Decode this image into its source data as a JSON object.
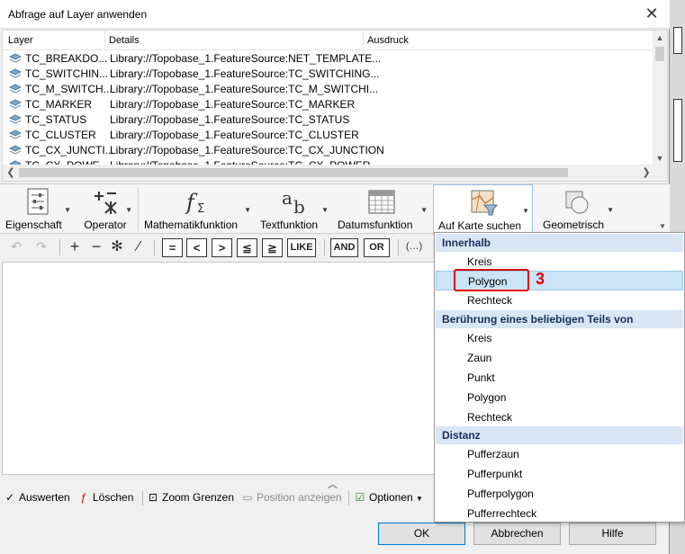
{
  "dialog": {
    "title": "Abfrage auf Layer anwenden",
    "close_glyph": "✕"
  },
  "layer_list": {
    "columns": [
      "Layer",
      "Details",
      "Ausdruck"
    ],
    "rows": [
      {
        "layer": "TC_BREAKDO...",
        "details": "Library://Topobase_1.FeatureSource:NET_TEMPLATE..."
      },
      {
        "layer": "TC_SWITCHIN...",
        "details": "Library://Topobase_1.FeatureSource:TC_SWITCHING..."
      },
      {
        "layer": "TC_M_SWITCH...",
        "details": "Library://Topobase_1.FeatureSource:TC_M_SWITCHI..."
      },
      {
        "layer": "TC_MARKER",
        "details": "Library://Topobase_1.FeatureSource:TC_MARKER"
      },
      {
        "layer": "TC_STATUS",
        "details": "Library://Topobase_1.FeatureSource:TC_STATUS"
      },
      {
        "layer": "TC_CLUSTER",
        "details": "Library://Topobase_1.FeatureSource:TC_CLUSTER"
      },
      {
        "layer": "TC_CX_JUNCTI...",
        "details": "Library://Topobase_1.FeatureSource:TC_CX_JUNCTION"
      },
      {
        "layer": "TC_CX_POWE...",
        "details": "Library://Topobase_1.FeatureSource:TC_CX_POWER"
      }
    ]
  },
  "ribbon": {
    "eigenschaft": "Eigenschaft",
    "operator": "Operator",
    "mathematik": "Mathematikfunktion",
    "text": "Textfunktion",
    "datum": "Datumsfunktion",
    "karte": "Auf Karte suchen",
    "geometrisch": "Geometrisch"
  },
  "toolbar": {
    "eq": "=",
    "lt": "<",
    "gt": ">",
    "le": "≦",
    "ge": "≧",
    "like": "LIKE",
    "and": "AND",
    "or": "OR",
    "paren": "(…)"
  },
  "bottom": {
    "auswerten": "Auswerten",
    "loeschen": "Löschen",
    "zoom": "Zoom Grenzen",
    "position": "Position anzeigen",
    "optionen": "Optionen"
  },
  "buttons": {
    "ok": "OK",
    "abbrechen": "Abbrechen",
    "hilfe": "Hilfe"
  },
  "menu": {
    "sections": [
      {
        "header": "Innerhalb",
        "items": [
          "Kreis",
          "Polygon",
          "Rechteck"
        ]
      },
      {
        "header": "Berührung eines beliebigen Teils von",
        "items": [
          "Kreis",
          "Zaun",
          "Punkt",
          "Polygon",
          "Rechteck"
        ]
      },
      {
        "header": "Distanz",
        "items": [
          "Pufferzaun",
          "Pufferpunkt",
          "Pufferpolygon",
          "Pufferrechteck"
        ]
      }
    ],
    "selected_item": "Polygon"
  },
  "annotation": {
    "step_number": "3",
    "color": "#e00000"
  }
}
